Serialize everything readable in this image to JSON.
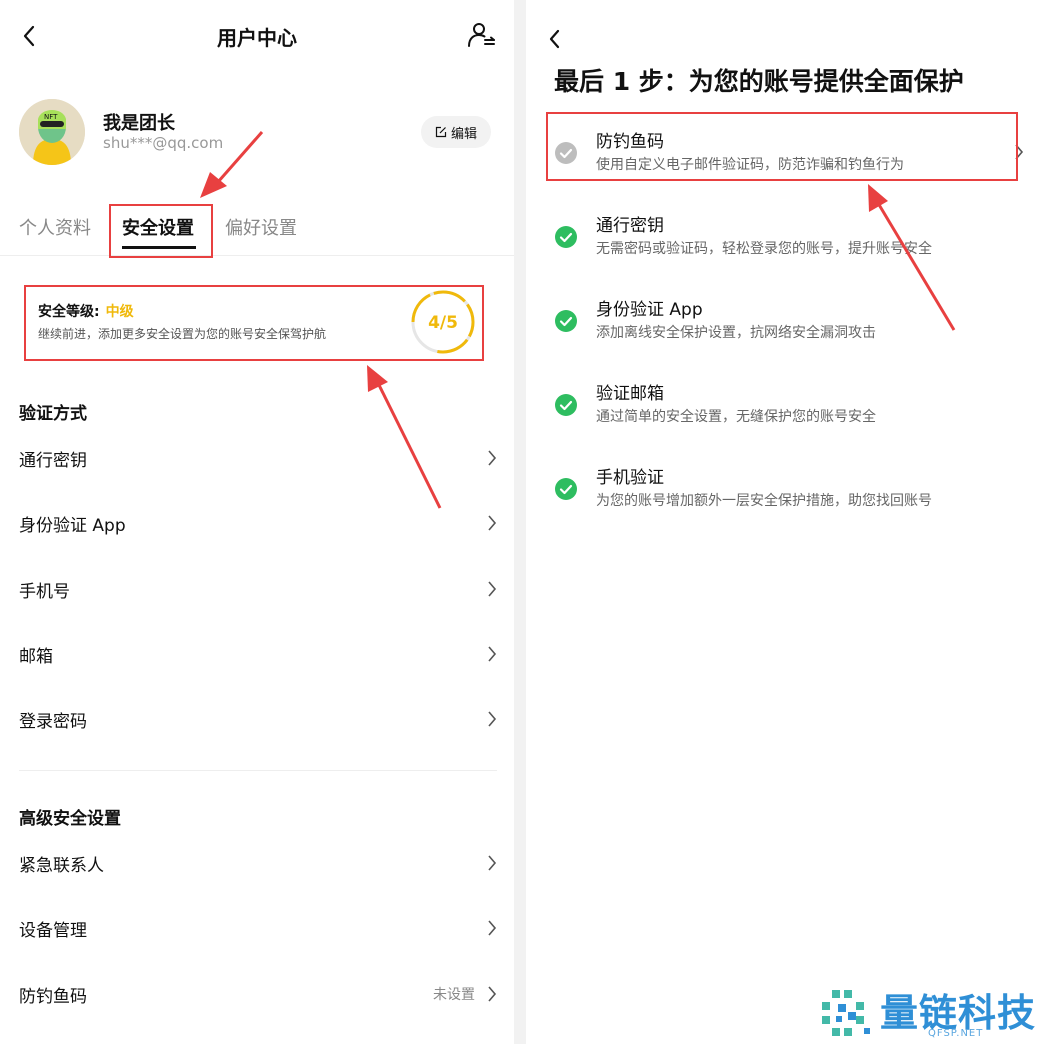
{
  "left": {
    "header": {
      "title": "用户中心"
    },
    "profile": {
      "name": "我是团长",
      "email": "shu***@qq.com",
      "edit_label": "编辑"
    },
    "tabs": [
      {
        "label": "个人资料",
        "active": false
      },
      {
        "label": "安全设置",
        "active": true
      },
      {
        "label": "偏好设置",
        "active": false
      }
    ],
    "security_card": {
      "level_label": "安全等级:",
      "level_value": "中级",
      "description": "继续前进，添加更多安全设置为您的账号安全保驾护航",
      "progress_text": "4/5",
      "progress_fraction": 0.8
    },
    "verification": {
      "title": "验证方式",
      "items": [
        {
          "label": "通行密钥"
        },
        {
          "label": "身份验证 App"
        },
        {
          "label": "手机号"
        },
        {
          "label": "邮箱"
        },
        {
          "label": "登录密码"
        }
      ]
    },
    "advanced": {
      "title": "高级安全设置",
      "items": [
        {
          "label": "紧急联系人",
          "value": ""
        },
        {
          "label": "设备管理",
          "value": ""
        },
        {
          "label": "防钓鱼码",
          "value": "未设置"
        }
      ]
    }
  },
  "right": {
    "title": "最后 1 步：为您的账号提供全面保护",
    "steps": [
      {
        "title": "防钓鱼码",
        "desc": "使用自定义电子邮件验证码，防范诈骗和钓鱼行为",
        "done": false
      },
      {
        "title": "通行密钥",
        "desc": "无需密码或验证码，轻松登录您的账号，提升账号安全",
        "done": true
      },
      {
        "title": "身份验证 App",
        "desc": "添加离线安全保护设置，抗网络安全漏洞攻击",
        "done": true
      },
      {
        "title": "验证邮箱",
        "desc": "通过简单的安全设置，无缝保护您的账号安全",
        "done": true
      },
      {
        "title": "手机验证",
        "desc": "为您的账号增加额外一层安全保护措施，助您找回账号",
        "done": true
      }
    ]
  },
  "watermark": {
    "text": "量链科技",
    "sub": "QFSP.NET"
  },
  "colors": {
    "accent": "#f0b90b",
    "check_green": "#2ebd60",
    "check_gray": "#bdbdbd",
    "annotation_red": "#e84040",
    "watermark_blue": "#2f8fd6"
  }
}
